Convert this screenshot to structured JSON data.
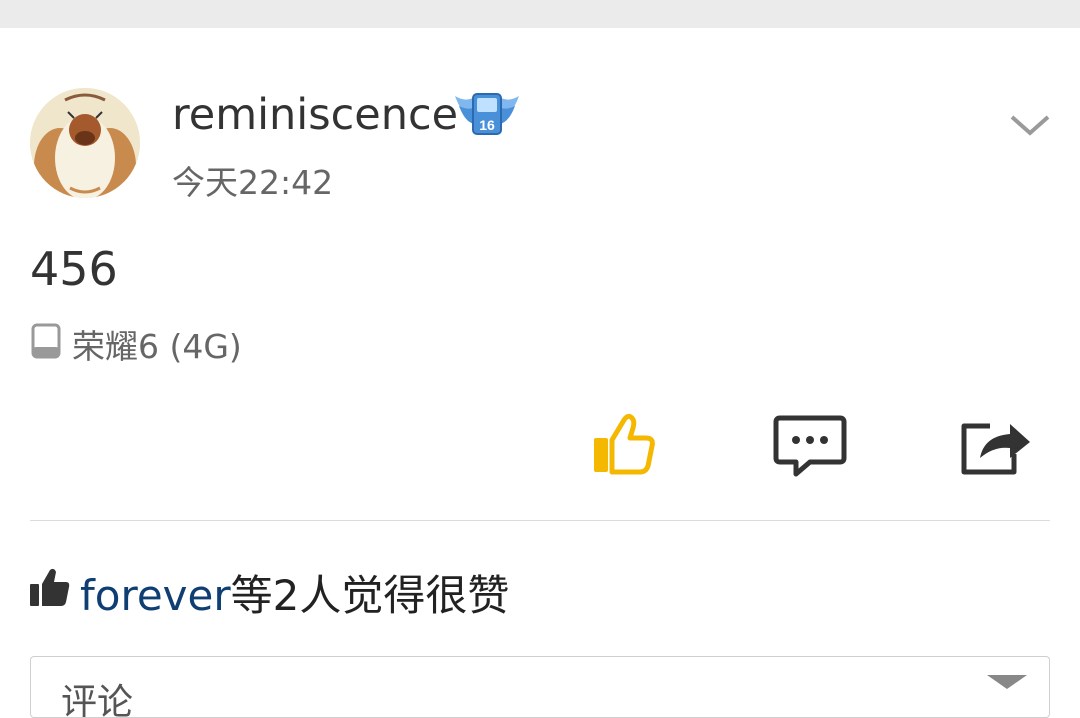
{
  "post": {
    "username": "reminiscence",
    "badge_level": "16",
    "timestamp": "今天22:42",
    "content": "456",
    "device": "荣耀6 (4G)"
  },
  "likes": {
    "name": "forever",
    "suffix": "等2人觉得很赞"
  },
  "comment_box": {
    "placeholder": "评论"
  },
  "icons": {
    "avatar": "avatar-image",
    "badge": "winged-level-badge-icon",
    "dropdown": "chevron-down-icon",
    "device": "phone-icon",
    "like": "thumbs-up-icon",
    "comment": "comment-bubble-icon",
    "share": "share-icon",
    "likes": "thumbs-up-filled-icon"
  },
  "colors": {
    "like_accent": "#f5b800",
    "name_link": "#0f3e73",
    "badge": "#4a90d9"
  }
}
